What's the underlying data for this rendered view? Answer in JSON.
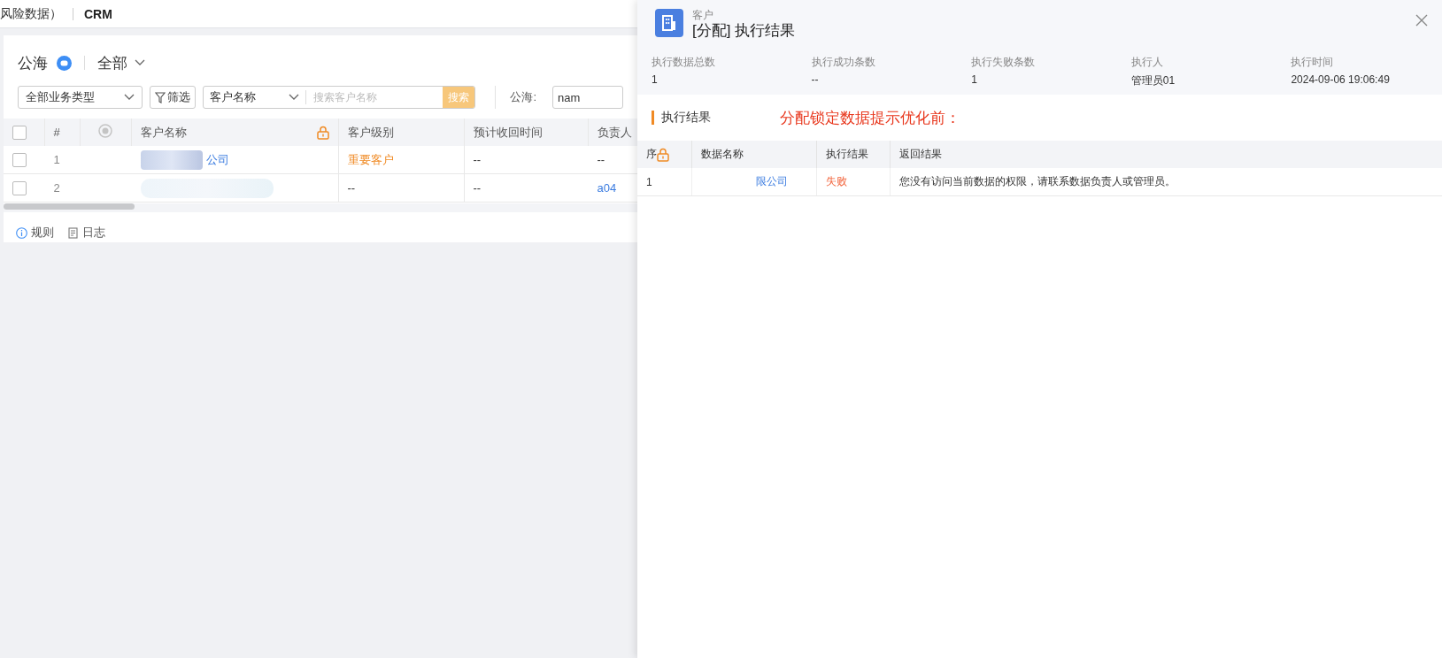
{
  "topbar": {
    "breadcrumb": "风险数据）",
    "app": "CRM"
  },
  "list": {
    "title": "公海",
    "view": "全部",
    "type_select": "全部业务类型",
    "filter_button": "筛选",
    "search_field": "客户名称",
    "search_placeholder": "搜索客户名称",
    "search_button": "搜索",
    "pool_label": "公海:",
    "pool_value": "nam",
    "select_all_checked": false,
    "columns": [
      "#",
      "客户名称",
      "客户级别",
      "预计收回时间",
      "负责人"
    ],
    "rows": [
      {
        "checked": false,
        "index": "1",
        "name": "公司",
        "level": "重要客户",
        "level_highlight": true,
        "due": "--",
        "owner": "--",
        "owner_link": false
      },
      {
        "checked": false,
        "index": "2",
        "level": "--",
        "level_highlight": false,
        "due": "--",
        "owner": "a04",
        "owner_link": true
      }
    ],
    "footer": [
      {
        "kind": "info",
        "label": "规则"
      },
      {
        "kind": "log",
        "label": "日志"
      }
    ]
  },
  "drawer": {
    "object": "客户",
    "title": "[分配] 执行结果",
    "stats": [
      {
        "label": "执行数据总数",
        "value": "1"
      },
      {
        "label": "执行成功条数",
        "value": "--"
      },
      {
        "label": "执行失败条数",
        "value": "1"
      },
      {
        "label": "执行人",
        "value": "管理员01"
      },
      {
        "label": "执行时间",
        "value": "2024-09-06 19:06:49"
      }
    ],
    "section": "执行结果",
    "note": "分配锁定数据提示优化前：",
    "columns": [
      "序",
      "数据名称",
      "执行结果",
      "返回结果"
    ],
    "rows": [
      {
        "index": "1",
        "name": "限公司",
        "result": "失败",
        "failed": true,
        "message": "您没有访问当前数据的权限，请联系数据负责人或管理员。"
      }
    ]
  }
}
